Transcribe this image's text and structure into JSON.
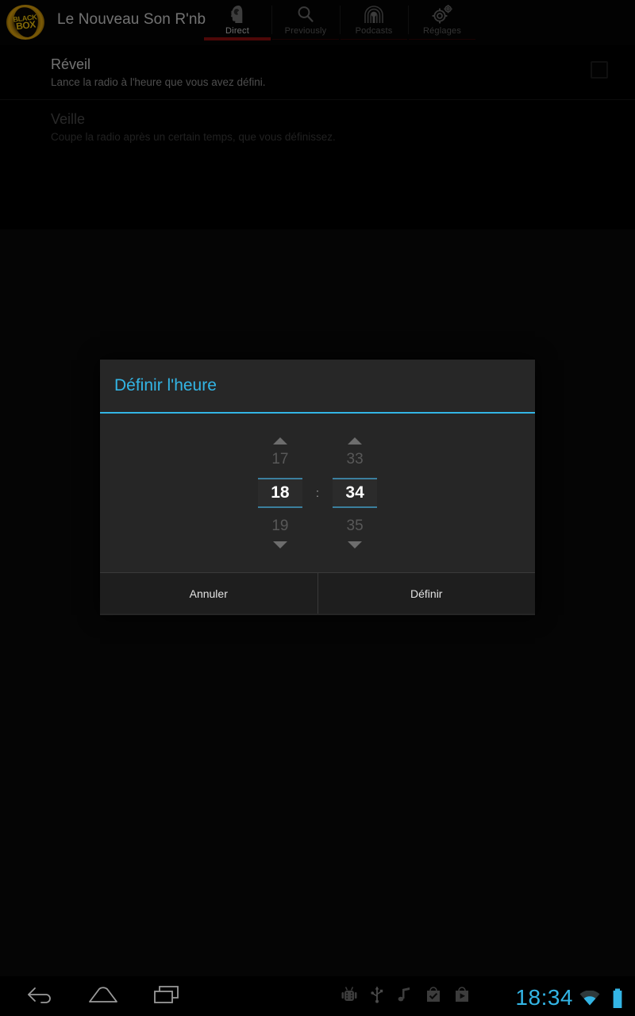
{
  "app": {
    "logo_line1": "BLACK",
    "logo_line2": "BOX",
    "logo_name": "blackbox-logo",
    "title": "Le Nouveau Son R'nb"
  },
  "tabs": [
    {
      "label": "Direct",
      "icon": "head-headset-icon",
      "active": true
    },
    {
      "label": "Previously",
      "icon": "search-icon",
      "active": false
    },
    {
      "label": "Podcasts",
      "icon": "podcast-icon",
      "active": false
    },
    {
      "label": "Réglages",
      "icon": "gears-icon",
      "active": false
    }
  ],
  "preferences": [
    {
      "title": "Réveil",
      "summary": "Lance la radio à l'heure que vous avez défini.",
      "enabled": true,
      "checkbox_checked": false
    },
    {
      "title": "Veille",
      "summary": "Coupe la radio après un certain temps, que vous définissez.",
      "enabled": false,
      "checkbox_checked": false
    }
  ],
  "dialog": {
    "title": "Définir l'heure",
    "hour": {
      "previous": "17",
      "selected": "18",
      "next": "19"
    },
    "separator": ":",
    "minute": {
      "previous": "33",
      "selected": "34",
      "next": "35"
    },
    "cancel_label": "Annuler",
    "confirm_label": "Définir"
  },
  "system_bar": {
    "nav": [
      {
        "name": "back-icon"
      },
      {
        "name": "home-icon"
      },
      {
        "name": "recents-icon"
      }
    ],
    "status_icons": [
      "android-debug-icon",
      "usb-icon",
      "music-note-icon",
      "play-store-installed-icon",
      "play-store-icon"
    ],
    "clock": "18:34",
    "wifi": "wifi-icon",
    "battery": "battery-full-icon"
  },
  "colors": {
    "accent_blue": "#33b5e5",
    "tab_active_underline": "#8e0f0f",
    "tab_inactive_underline": "#2e0505",
    "picker_divider": "#3b7f9e",
    "dialog_bg": "#262626",
    "logo_gold": "#e0a50c"
  }
}
